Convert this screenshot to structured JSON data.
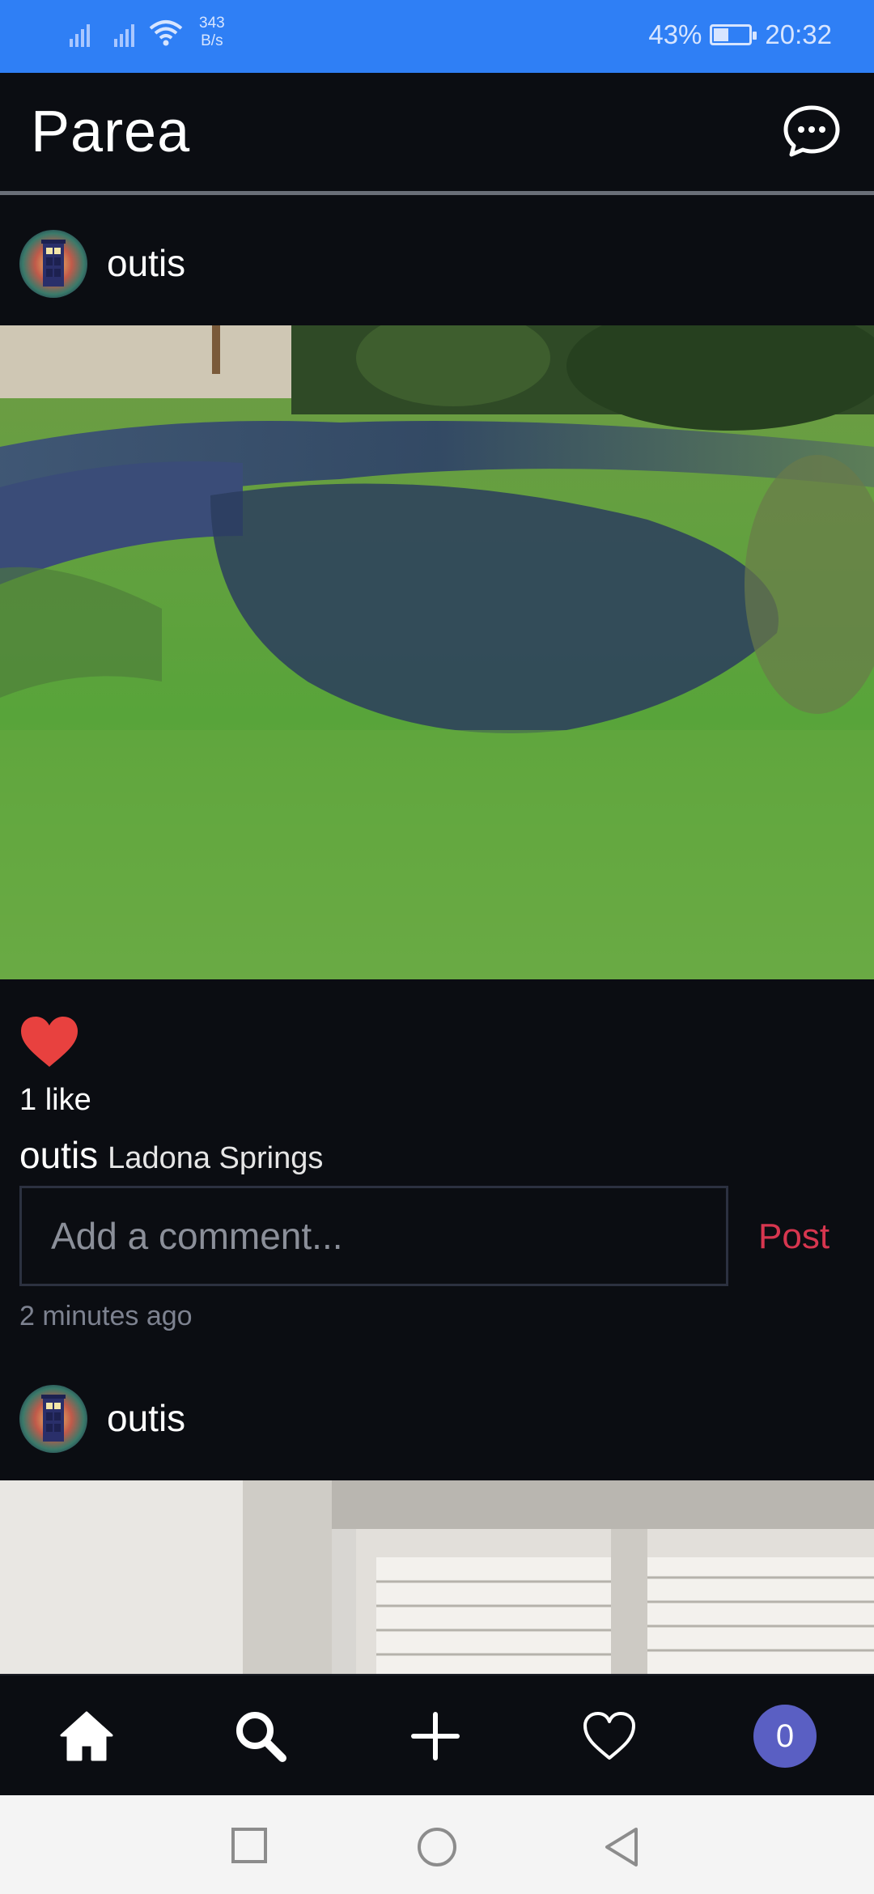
{
  "status_bar": {
    "net_speed_value": "343",
    "net_speed_unit": "B/s",
    "battery_percent": "43%",
    "battery_level": 0.43,
    "time": "20:32"
  },
  "app": {
    "title": "Parea",
    "messages_icon": "chat-bubble-icon"
  },
  "posts": [
    {
      "username": "outis",
      "avatar_icon": "tardis-avatar",
      "photo": "river-spring-photo",
      "liked": true,
      "likes_text": "1 like",
      "caption_user": "outis",
      "caption_text": "Ladona Springs",
      "comment_placeholder": "Add a comment...",
      "post_label": "Post",
      "time_ago": "2 minutes ago"
    },
    {
      "username": "outis",
      "avatar_icon": "tardis-avatar",
      "photo": "window-shutter-photo"
    }
  ],
  "bottom_nav": {
    "items": [
      "home-icon",
      "search-icon",
      "add-icon",
      "heart-icon"
    ],
    "notification_count": "0"
  },
  "system_nav": [
    "recents-button",
    "home-button",
    "back-button"
  ],
  "colors": {
    "status_bar": "#2f7ff5",
    "background": "#0b0d12",
    "like_red": "#e8413f",
    "post_button": "#d7364f",
    "badge": "#5a5fc3"
  }
}
